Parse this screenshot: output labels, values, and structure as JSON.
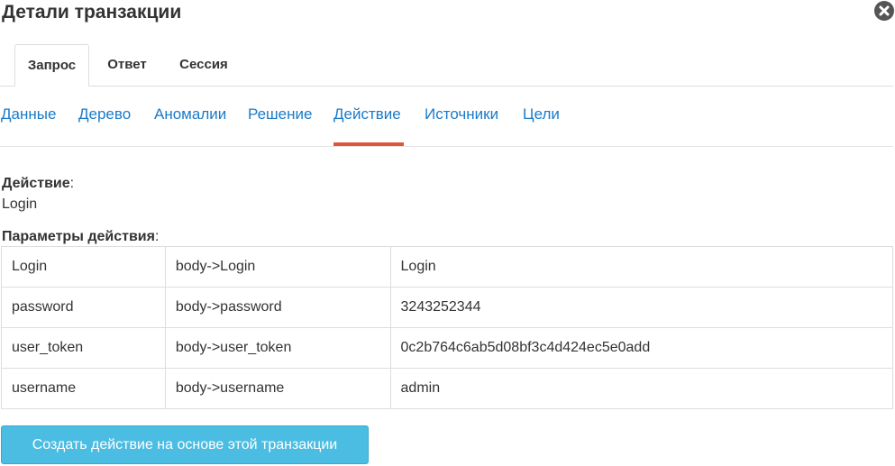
{
  "dialog": {
    "title": "Детали транзакции"
  },
  "main_tabs": [
    {
      "label": "Запрос",
      "active": true
    },
    {
      "label": "Ответ",
      "active": false
    },
    {
      "label": "Сессия",
      "active": false
    }
  ],
  "sub_tabs": [
    {
      "label": "Данные",
      "active": false
    },
    {
      "label": "Дерево",
      "active": false
    },
    {
      "label": "Аномалии",
      "active": false
    },
    {
      "label": "Решение",
      "active": false
    },
    {
      "label": "Действие",
      "active": true
    },
    {
      "label": "Источники",
      "active": false
    },
    {
      "label": "Цели",
      "active": false
    }
  ],
  "action": {
    "label": "Действие",
    "value": "Login"
  },
  "params": {
    "label": "Параметры действия",
    "rows": [
      {
        "name": "Login",
        "path": "body->Login",
        "value": "Login"
      },
      {
        "name": "password",
        "path": "body->password",
        "value": "3243252344"
      },
      {
        "name": "user_token",
        "path": "body->user_token",
        "value": "0c2b764c6ab5d08bf3c4d424ec5e0add"
      },
      {
        "name": "username",
        "path": "body->username",
        "value": "admin"
      }
    ]
  },
  "create_button": {
    "label": "Создать действие на основе этой транзакции"
  },
  "colors": {
    "link": "#1a7bc9",
    "active_underline": "#e0553a",
    "button": "#4bbde3"
  }
}
